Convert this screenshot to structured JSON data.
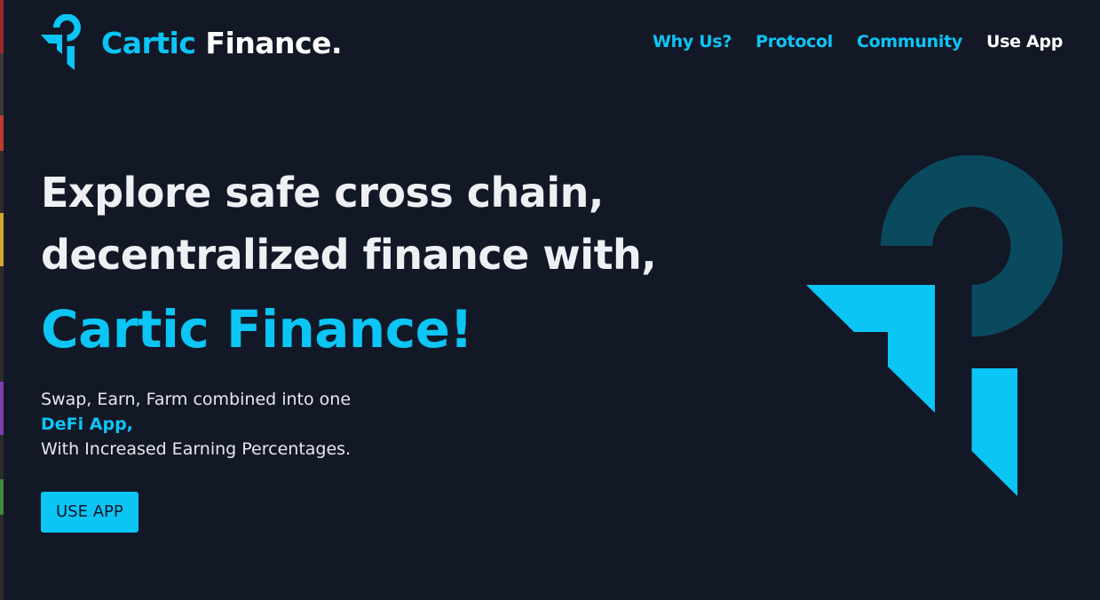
{
  "header": {
    "brand_primary": "Cartic",
    "brand_secondary": "Finance.",
    "nav": [
      {
        "label": "Why Us?"
      },
      {
        "label": "Protocol"
      },
      {
        "label": "Community"
      },
      {
        "label": "Use App"
      }
    ]
  },
  "hero": {
    "headline_line1": "Explore safe cross chain,",
    "headline_line2": "decentralized finance with,",
    "accent": "Cartic Finance!",
    "sub_line1": "Swap, Earn, Farm combined into one",
    "sub_highlight": "DeFi App,",
    "sub_line3": "With Increased Earning Percentages.",
    "cta_label": "USE APP"
  },
  "colors": {
    "background": "#131826",
    "accent": "#0bc5f5",
    "accent_dark": "#0a4a5e",
    "text": "#eef0f3"
  },
  "icons": {
    "logo": "cartic-logo-icon",
    "hero": "cartic-mark-illustration"
  }
}
